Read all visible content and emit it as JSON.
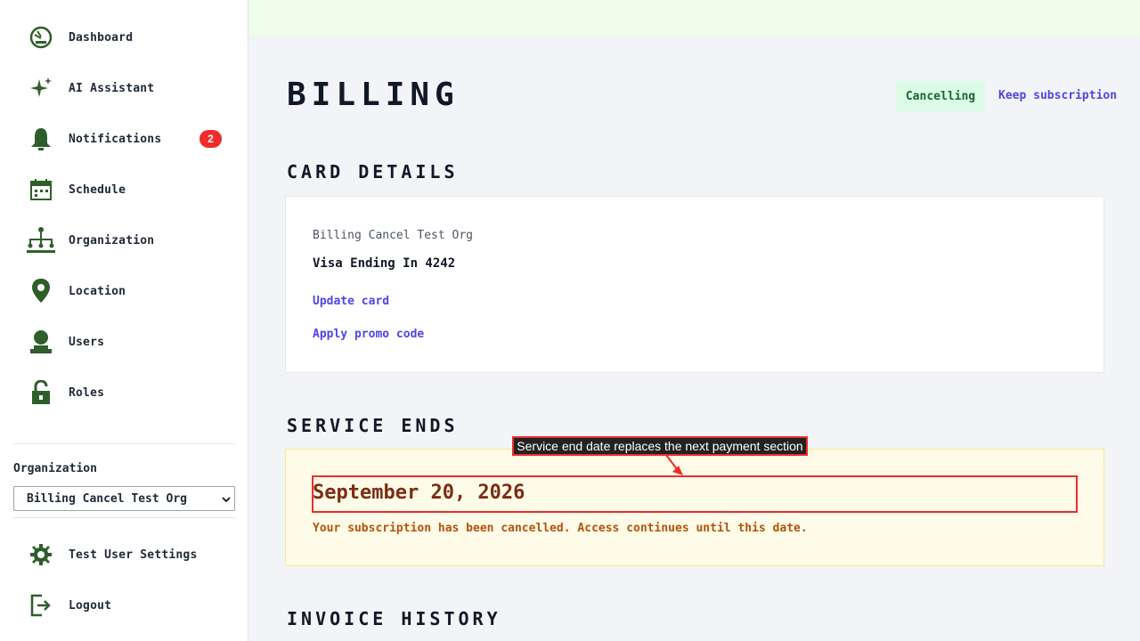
{
  "sidebar": {
    "items": [
      {
        "label": "Dashboard",
        "icon": "dashboard-icon"
      },
      {
        "label": "AI Assistant",
        "icon": "sparkle-icon"
      },
      {
        "label": "Notifications",
        "icon": "bell-icon",
        "badge": "2"
      },
      {
        "label": "Schedule",
        "icon": "calendar-icon"
      },
      {
        "label": "Organization",
        "icon": "org-chart-icon"
      },
      {
        "label": "Location",
        "icon": "map-pin-icon"
      },
      {
        "label": "Users",
        "icon": "user-icon"
      },
      {
        "label": "Roles",
        "icon": "lock-icon"
      }
    ],
    "org_label": "Organization",
    "org_selected": "Billing Cancel Test Org",
    "settings_label": "Test User Settings",
    "logout_label": "Logout"
  },
  "page": {
    "title": "BILLING",
    "status": "Cancelling",
    "keep_link": "Keep subscription"
  },
  "card_details": {
    "title": "CARD DETAILS",
    "org_name": "Billing Cancel Test Org",
    "card": "Visa Ending In 4242",
    "update_link": "Update card",
    "promo_link": "Apply promo code"
  },
  "service_ends": {
    "title": "SERVICE ENDS",
    "date": "September 20, 2026",
    "message": "Your subscription has been cancelled. Access continues until this date."
  },
  "invoice_history": {
    "title": "INVOICE HISTORY"
  },
  "annotation": {
    "text": "Service end date replaces the next payment section"
  },
  "colors": {
    "accent": "#4f46e5",
    "icon_green": "#2f5e2a",
    "badge_red": "#ef2b2b",
    "status_bg": "#dcfce7",
    "status_text": "#166534",
    "notice_bg": "#fefbe8",
    "notice_date": "#7c2d12",
    "notice_text": "#b45309"
  }
}
